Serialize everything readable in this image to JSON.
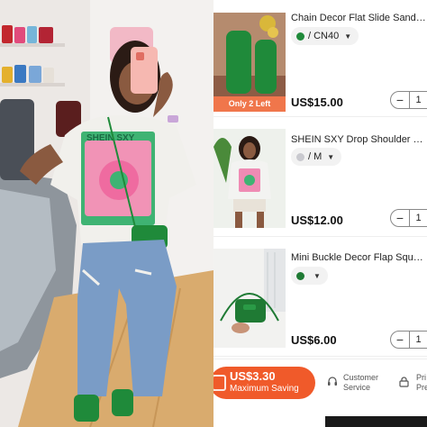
{
  "cart": {
    "items": [
      {
        "title": "Chain Decor Flat Slide Sandals",
        "variant_text": "/ CN40",
        "variant_color": "#1f8a3a",
        "price": "US$15.00",
        "quantity": "1",
        "badge": "Only 2 Left"
      },
      {
        "title": "SHEIN SXY Drop Shoulder Lette...",
        "variant_text": "/ M",
        "variant_color": "#c9c9cf",
        "price": "US$12.00",
        "quantity": "1"
      },
      {
        "title": "Mini Buckle Decor Flap Square...",
        "variant_text": "",
        "variant_color": "#1f7a34",
        "price": "US$6.00",
        "quantity": "1"
      }
    ],
    "saving": {
      "amount": "US$3.30",
      "label": "Maximum Saving"
    },
    "customer_service": {
      "line1": "Customer",
      "line2": "Service"
    },
    "privacy": {
      "line1": "Pri",
      "line2": "Pre"
    }
  },
  "photo": {
    "shirt_text": "SHEIN SXY"
  },
  "colors": {
    "accent_orange": "#f05a2a",
    "badge_orange": "#f0764b",
    "green": "#1f8a3a"
  },
  "icons": [
    "chevron-down-icon",
    "headset-icon",
    "lock-icon",
    "logo-icon"
  ]
}
